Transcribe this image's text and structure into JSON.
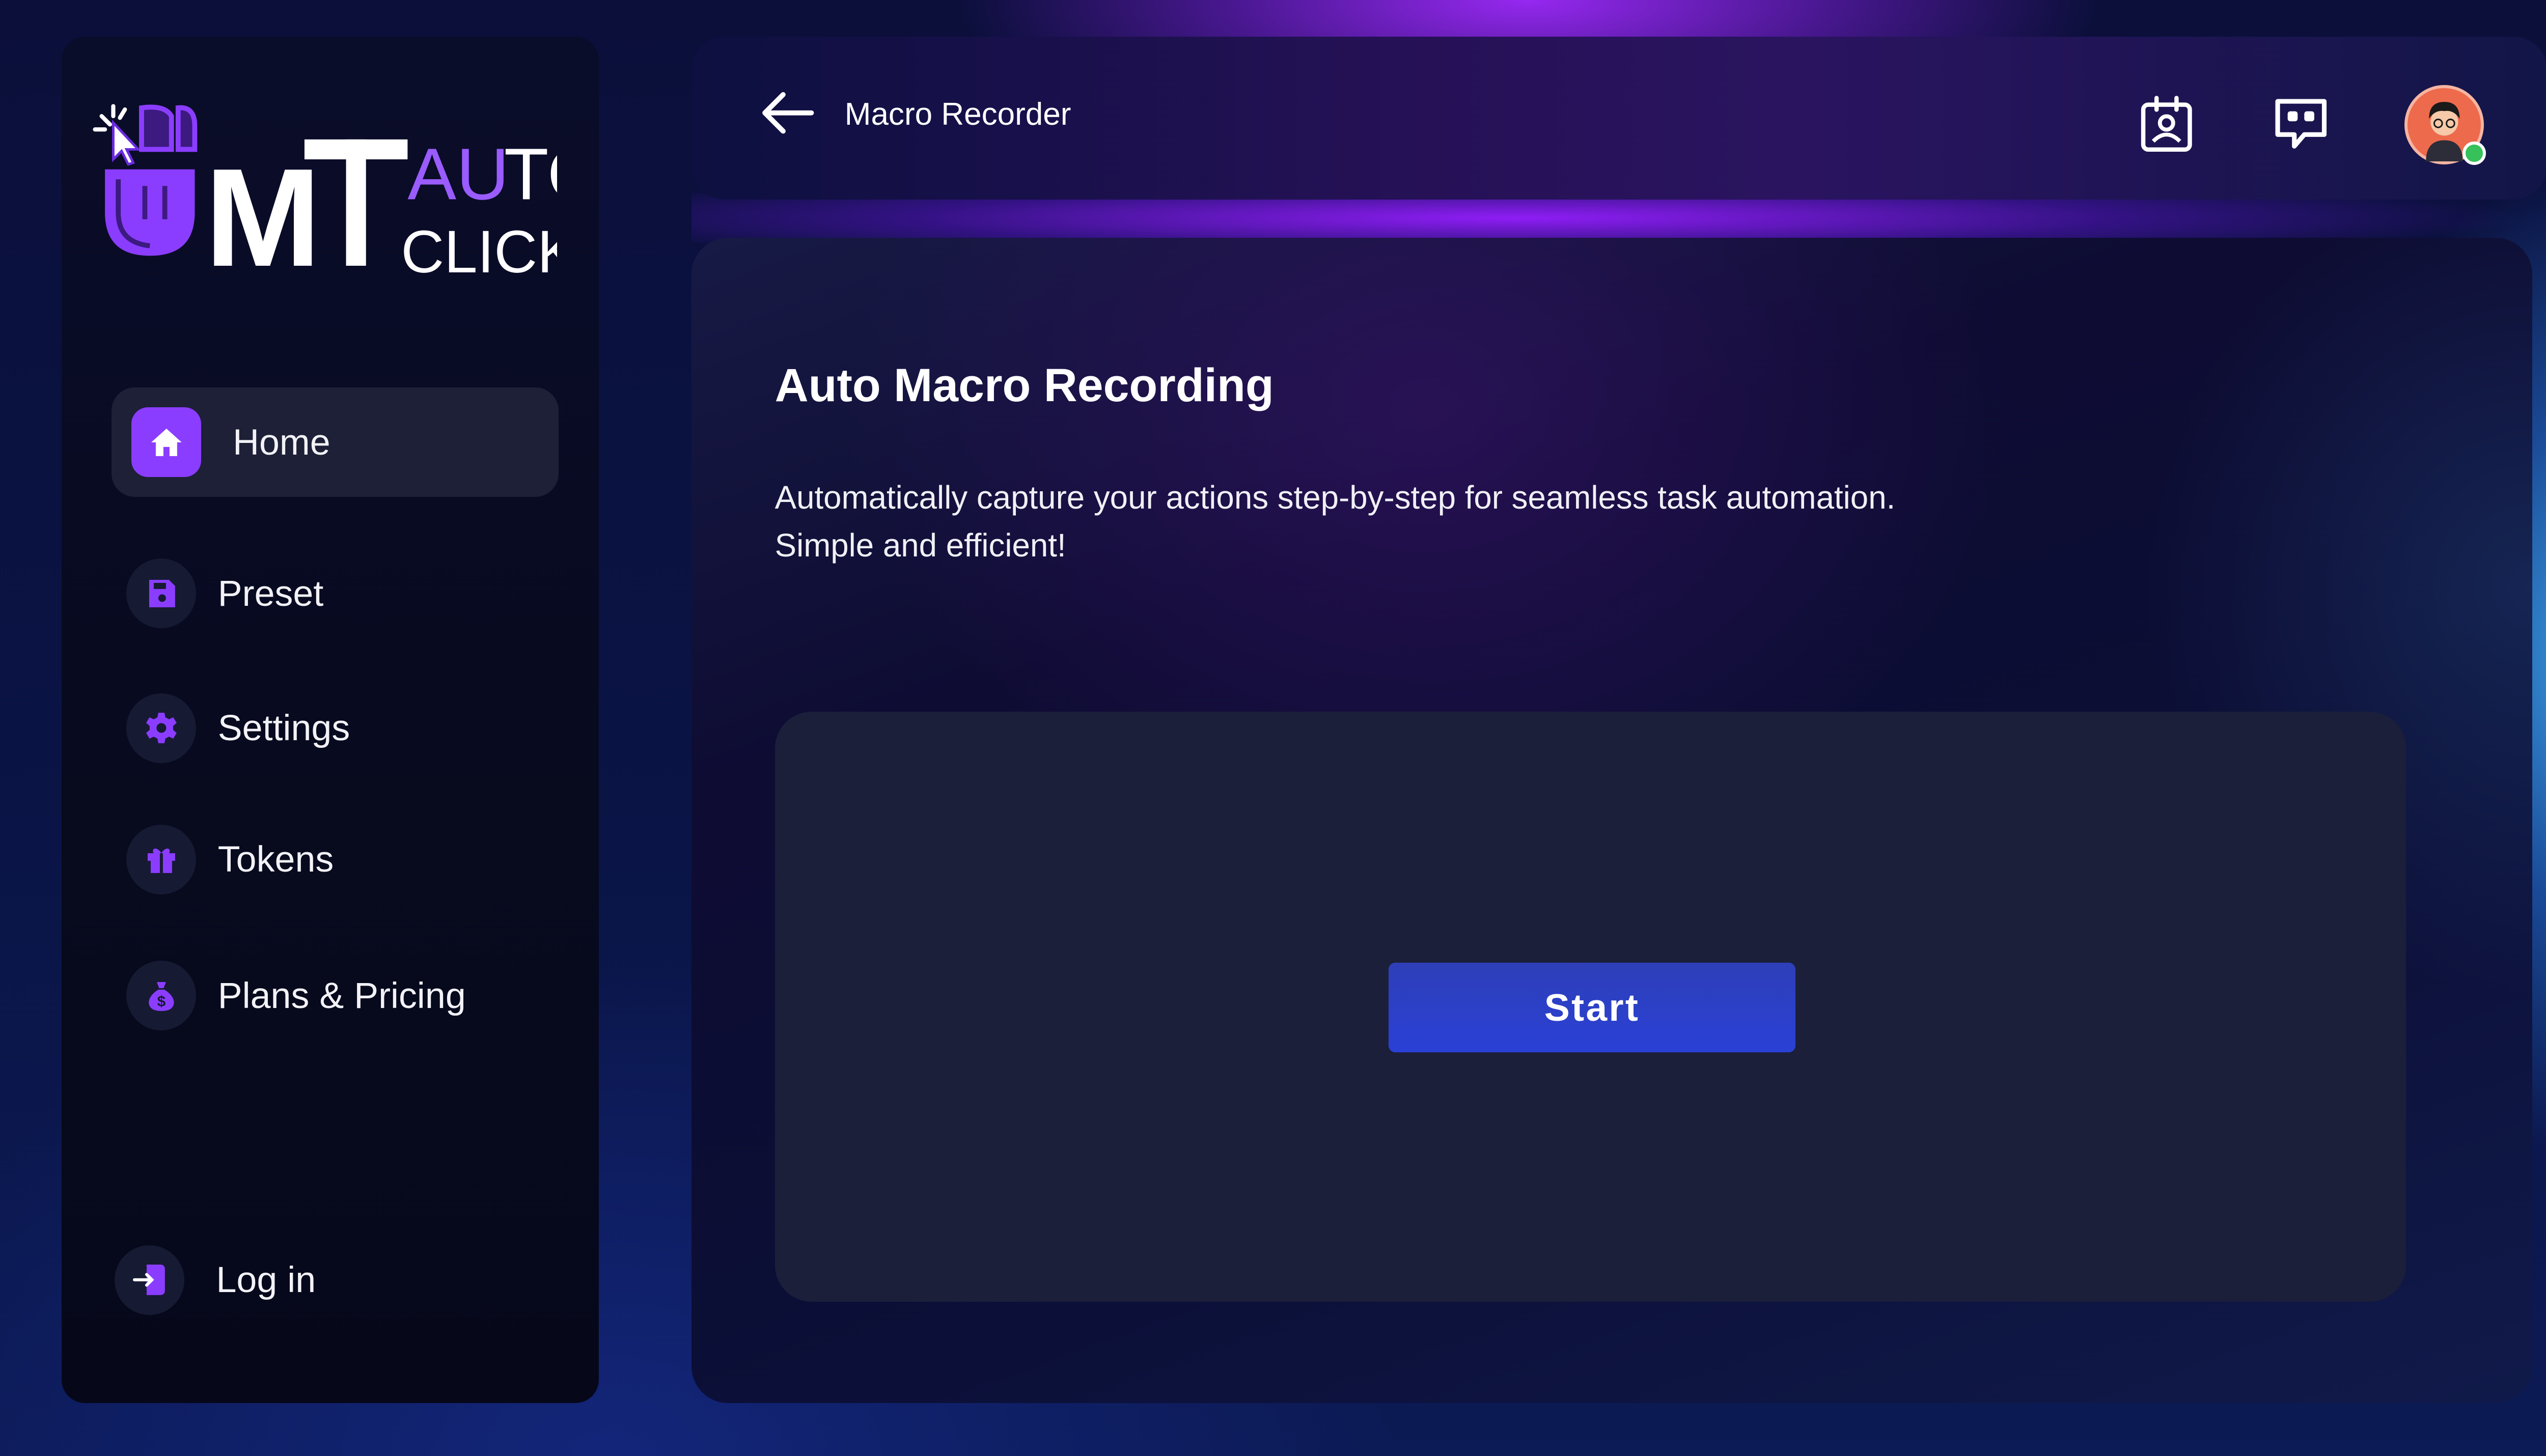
{
  "app": {
    "logo": {
      "line1_m": "M",
      "line1_t": "T",
      "line1_auto": "AUTO",
      "line2": "CLICKER"
    }
  },
  "sidebar": {
    "items": [
      {
        "label": "Home",
        "icon": "home-icon",
        "active": true
      },
      {
        "label": "Preset",
        "icon": "save-icon",
        "active": false
      },
      {
        "label": "Settings",
        "icon": "gear-icon",
        "active": false
      },
      {
        "label": "Tokens",
        "icon": "gift-icon",
        "active": false
      },
      {
        "label": "Plans & Pricing",
        "icon": "money-bag-icon",
        "active": false
      }
    ],
    "login": {
      "label": "Log in",
      "icon": "login-icon"
    }
  },
  "header": {
    "title": "Macro Recorder",
    "back_icon": "arrow-left-icon",
    "actions": [
      {
        "icon": "contact-card-icon"
      },
      {
        "icon": "chat-support-icon"
      }
    ],
    "avatar_status": "online"
  },
  "main": {
    "title": "Auto Macro Recording",
    "description": "Automatically capture your actions step-by-step for seamless task automation. Simple and efficient!",
    "start_label": "Start"
  },
  "colors": {
    "accent_purple": "#8b3dff",
    "button_blue": "#2a40d6",
    "panel_bg": "#1c1f3a",
    "online_green": "#36c15a"
  }
}
